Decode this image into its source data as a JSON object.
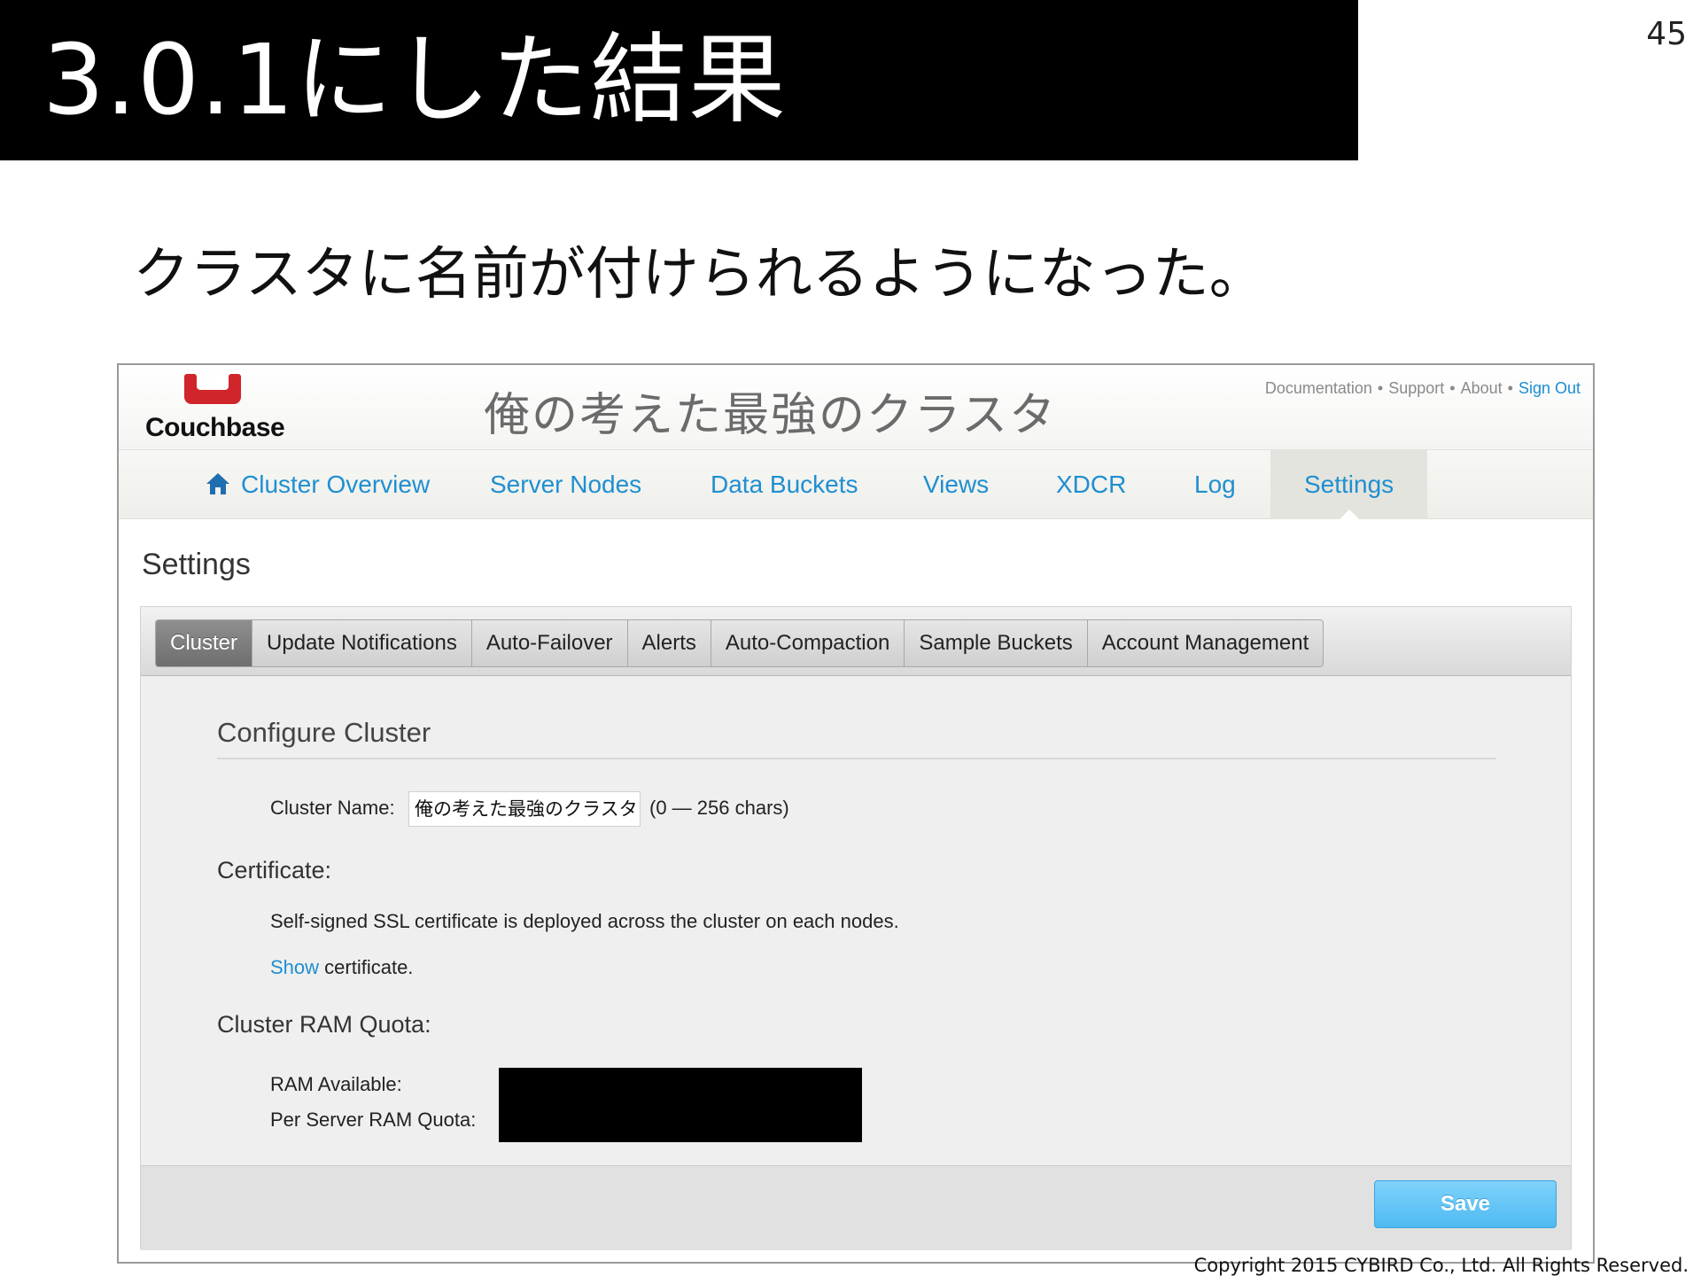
{
  "slide": {
    "title": "3.0.1にした結果",
    "page_number": "45",
    "subtitle": "クラスタに名前が付けられるようになった。",
    "copyright": "Copyright 2015 CYBIRD Co., Ltd.  All Rights Reserved."
  },
  "app": {
    "logo_text": "Couchbase",
    "cluster_title": "俺の考えた最強のクラスタ",
    "top_links": {
      "documentation": "Documentation",
      "support": "Support",
      "about": "About",
      "sign_out": "Sign Out",
      "separator": "•"
    },
    "nav": {
      "cluster_overview": "Cluster Overview",
      "server_nodes": "Server Nodes",
      "data_buckets": "Data Buckets",
      "views": "Views",
      "xdcr": "XDCR",
      "log": "Log",
      "settings": "Settings"
    },
    "page_heading": "Settings",
    "tabs": {
      "cluster": "Cluster",
      "update_notifications": "Update Notifications",
      "auto_failover": "Auto-Failover",
      "alerts": "Alerts",
      "auto_compaction": "Auto-Compaction",
      "sample_buckets": "Sample Buckets",
      "account_management": "Account Management"
    },
    "configure": {
      "title": "Configure Cluster",
      "cluster_name_label": "Cluster Name:",
      "cluster_name_value": "俺の考えた最強のクラスタ",
      "cluster_name_hint": "(0 — 256 chars)",
      "certificate_label": "Certificate:",
      "certificate_text": "Self-signed SSL certificate is deployed across the cluster on each nodes.",
      "show_link": "Show",
      "certificate_suffix": " certificate.",
      "ram_quota_label": "Cluster RAM Quota:",
      "ram_available_label": "RAM Available:",
      "per_server_label": "Per Server RAM Quota:"
    },
    "save_label": "Save"
  },
  "colors": {
    "link_blue": "#1f8fd0",
    "brand_red": "#d0252a",
    "save_blue": "#5fc2f5"
  }
}
